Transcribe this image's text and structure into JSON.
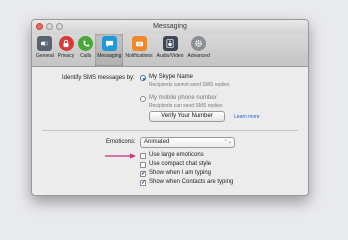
{
  "window": {
    "title": "Messaging"
  },
  "toolbar": {
    "items": [
      {
        "label": "General",
        "icon": "switch-icon",
        "color": "#5a6470"
      },
      {
        "label": "Privacy",
        "icon": "lock-icon",
        "color": "#d63b3b"
      },
      {
        "label": "Calls",
        "icon": "phone-icon",
        "color": "#49a83a"
      },
      {
        "label": "Messaging",
        "icon": "chat-bubble-icon",
        "color": "#1f9ad6"
      },
      {
        "label": "Notifications",
        "icon": "notification-icon",
        "color": "#ef8a2a"
      },
      {
        "label": "Audio/Video",
        "icon": "speaker-icon",
        "color": "#3b4757"
      },
      {
        "label": "Advanced",
        "icon": "gear-icon",
        "color": "#8a8f96"
      }
    ]
  },
  "sms": {
    "label": "Identify SMS messages by:",
    "option1_label": "My Skype Name",
    "option1_sub": "Recipients cannot send SMS replies",
    "option2_label": "My mobile phone number",
    "option2_sub": "Recipients can send SMS replies",
    "verify_button": "Verify Your Number",
    "learn_more": "Learn more"
  },
  "emoticons": {
    "label": "Emoticons:",
    "selected": "Animated",
    "chevron": "⌃⌄"
  },
  "checkboxes": [
    {
      "label": "Use large emoticons",
      "checked": false
    },
    {
      "label": "Use compact chat style",
      "checked": false
    },
    {
      "label": "Show when I am typing",
      "checked": true
    },
    {
      "label": "Show when Contacts are typing",
      "checked": true
    }
  ],
  "annotation": {
    "arrow": "→",
    "color": "#d0307a"
  },
  "check_mark": "✓"
}
